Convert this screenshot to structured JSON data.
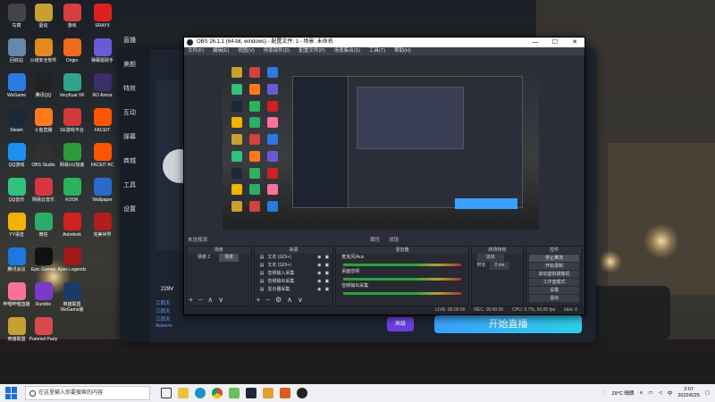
{
  "desktop_icons": [
    {
      "label": "鸟窝",
      "color": "#444"
    },
    {
      "label": "驱动",
      "color": "#c8a030"
    },
    {
      "label": "游戏",
      "color": "#d43f3f"
    },
    {
      "label": "SRAYX",
      "color": "#e02020"
    },
    {
      "label": "回收站",
      "color": "#6688aa"
    },
    {
      "label": "火绒安全软件",
      "color": "#e08a20"
    },
    {
      "label": "Origin",
      "color": "#f06a20"
    },
    {
      "label": "弹幕姬助手",
      "color": "#6b5ad8"
    },
    {
      "label": "WeGame",
      "color": "#2a7ae2"
    },
    {
      "label": "腾讯QQ",
      "color": "#222"
    },
    {
      "label": "VeryKuai VK",
      "color": "#2fa48a"
    },
    {
      "label": "RO Arena",
      "color": "#3a2f6a"
    },
    {
      "label": "Steam",
      "color": "#1b2838"
    },
    {
      "label": "斗鱼直播",
      "color": "#ff7a1a"
    },
    {
      "label": "SE游戏平台",
      "color": "#d23a3a"
    },
    {
      "label": "FACEIT",
      "color": "#ff5500"
    },
    {
      "label": "QQ游戏",
      "color": "#1d8ff0"
    },
    {
      "label": "OBS Studio",
      "color": "#303030"
    },
    {
      "label": "网易UU加速",
      "color": "#2a9a3a"
    },
    {
      "label": "FACEIT AC",
      "color": "#ff5500"
    },
    {
      "label": "QQ音乐",
      "color": "#31c27c"
    },
    {
      "label": "网易云音乐",
      "color": "#d9363e"
    },
    {
      "label": "KOOK",
      "color": "#2ab35c"
    },
    {
      "label": "Wallpaper",
      "color": "#2a6acc"
    },
    {
      "label": "YY语音",
      "color": "#f0b400"
    },
    {
      "label": "微信",
      "color": "#2aae67"
    },
    {
      "label": "Autodesk",
      "color": "#d02020"
    },
    {
      "label": "完美世界",
      "color": "#b01e1e"
    },
    {
      "label": "腾讯会议",
      "color": "#1a7ae2"
    },
    {
      "label": "Epic Games",
      "color": "#111"
    },
    {
      "label": "Apex Legends",
      "color": "#a01818"
    },
    {
      "label": "哔哩哔哩直播",
      "color": "#fb7299"
    },
    {
      "label": "Rumble",
      "color": "#7a3ac8"
    },
    {
      "label": "英雄联盟 WeGame版",
      "color": "#1a3a6a"
    },
    {
      "label": "英雄联盟",
      "color": "#c8a030"
    },
    {
      "label": "Pummel Party",
      "color": "#d84a4a"
    }
  ],
  "obs": {
    "title": "OBS 26.1.1 (64-bit, windows) - 配置文件: 1 - 场景: 未命名",
    "min": "—",
    "max": "☐",
    "close": "✕",
    "menu": [
      "文件(F)",
      "编辑(E)",
      "视图(V)",
      "停靠部件(D)",
      "配置文件(P)",
      "场景集合(S)",
      "工具(T)",
      "帮助(H)"
    ],
    "preview_tabs": [
      "未选择源",
      "属性",
      "滤镜"
    ],
    "docks": {
      "scenes": {
        "title": "场景",
        "items": [
          "场景 2",
          "场景"
        ]
      },
      "sources": {
        "title": "来源",
        "items": [
          "文本 (GDI+)",
          "文本 (GDI+)",
          "音频输入采集",
          "音频输出采集",
          "显示器采集"
        ]
      },
      "mixer": {
        "title": "混音器",
        "items": [
          "麦克风/Aux",
          "桌面音频",
          "音频输出采集"
        ]
      },
      "transitions": {
        "title": "转场特效",
        "type": "淡出",
        "duration_label": "时长",
        "duration": "0 ms"
      },
      "controls": {
        "title": "控件",
        "buttons": [
          "停止推流",
          "开始录制",
          "启动虚拟摄像机",
          "工作室模式",
          "设置",
          "退出"
        ]
      }
    },
    "status": {
      "live": "LIVE: 00:00:00",
      "rec": "REC: 00:00:00",
      "cpu": "CPU: 0.7%, 60.00 fps",
      "kbps": "kb/s: 0"
    }
  },
  "app": {
    "bitrate": "229V",
    "sidebar": [
      "直播",
      "美颜",
      "特效",
      "互动",
      "弹幕",
      "商城",
      "工具",
      "设置"
    ],
    "rows": [
      "江西天",
      "江西天",
      "江西天",
      "Ackerm"
    ],
    "start_label": "开始直播",
    "small_btn": "高级"
  },
  "taskbar": {
    "search_placeholder": "在这里输入你要搜索的内容",
    "weather": "29°C 晴朗",
    "time": "2:07",
    "date": "2022/6/25"
  }
}
